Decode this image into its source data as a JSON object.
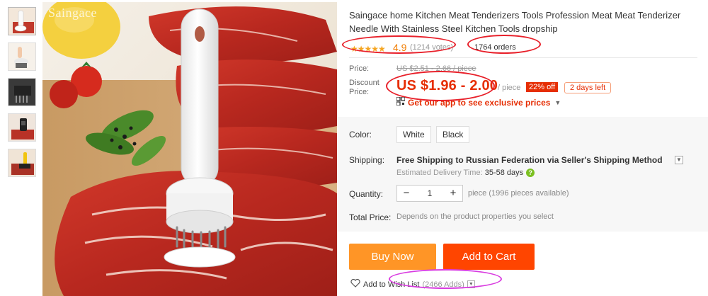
{
  "gallery": {
    "watermark": "Saingace",
    "thumbnails": [
      "thumb-1",
      "thumb-2",
      "thumb-3",
      "thumb-4",
      "thumb-5"
    ]
  },
  "product": {
    "title": "Saingace home Kitchen Meat Tenderizers Tools Profession Meat Meat Tenderizer Needle With Stainless Steel Kitchen Tools dropship",
    "stars": "★★★★★",
    "rating": "4.9",
    "votes": "(1214 votes)",
    "orders": "1764 orders"
  },
  "pricing": {
    "price_label": "Price:",
    "original_price": "US $2.51 - 2.66 / piece",
    "discount_label_line1": "Discount",
    "discount_label_line2": "Price:",
    "discount_price": "US $1.96 - 2.00",
    "per_piece": "/ piece",
    "discount_badge": "22% off",
    "days_left": "2 days left",
    "app_promo": "Get our app to see exclusive prices"
  },
  "options": {
    "color_label": "Color:",
    "colors": [
      "White",
      "Black"
    ],
    "shipping_label": "Shipping:",
    "shipping_bold": "Free Shipping to",
    "shipping_rest": " Russian Federation via Seller's Shipping Method",
    "delivery_label": "Estimated Delivery Time: ",
    "delivery_days": "35-58",
    "delivery_unit": " days",
    "quantity_label": "Quantity:",
    "quantity_value": "1",
    "quantity_minus": "−",
    "quantity_plus": "+",
    "pieces_available": "piece (1996 pieces available)",
    "total_label": "Total Price:",
    "total_note": "Depends on the product properties you select"
  },
  "actions": {
    "buy_now": "Buy Now",
    "add_to_cart": "Add to Cart",
    "wish_list": "Add to Wish List",
    "wish_adds": "(2466 Adds)"
  },
  "colors": {
    "price_red": "#e62e04",
    "buy_now_orange": "#ff9526",
    "add_cart_red": "#ff4500",
    "annotation_red": "#e8202a",
    "annotation_magenta": "#d93ce0",
    "star_gold": "#f5a623"
  }
}
